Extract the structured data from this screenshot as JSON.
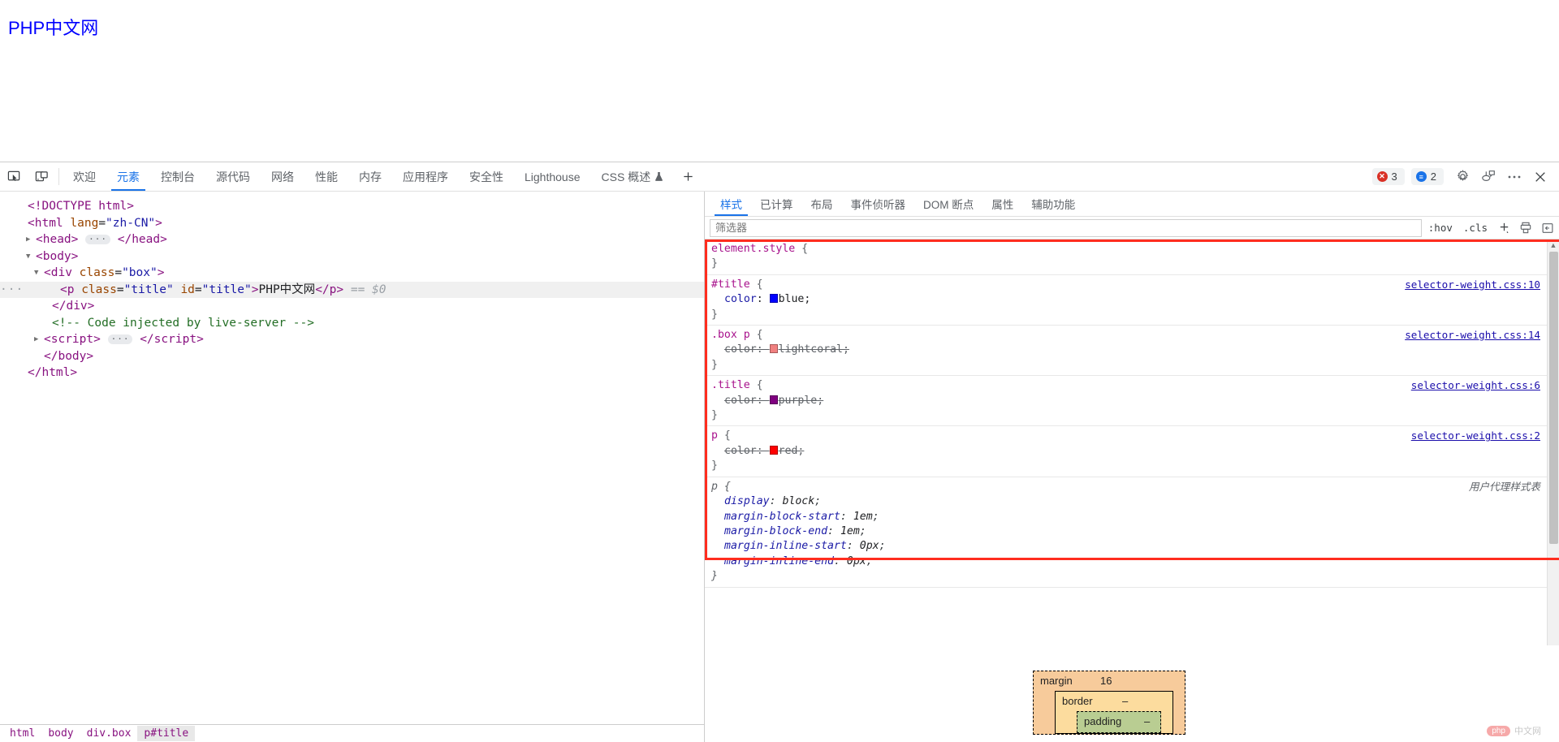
{
  "page": {
    "title_text": "PHP中文网",
    "title_color": "#0000ff"
  },
  "toolbar": {
    "inspect_icon": "inspect-element-icon",
    "device_icon": "device-toolbar-icon",
    "tabs": [
      {
        "label": "欢迎",
        "active": false
      },
      {
        "label": "元素",
        "active": true
      },
      {
        "label": "控制台",
        "active": false
      },
      {
        "label": "源代码",
        "active": false
      },
      {
        "label": "网络",
        "active": false
      },
      {
        "label": "性能",
        "active": false
      },
      {
        "label": "内存",
        "active": false
      },
      {
        "label": "应用程序",
        "active": false
      },
      {
        "label": "安全性",
        "active": false
      },
      {
        "label": "Lighthouse",
        "active": false
      },
      {
        "label": "CSS 概述",
        "active": false,
        "flask": "🧪"
      }
    ],
    "add_tab_label": "+",
    "error_count": "3",
    "message_count": "2",
    "settings_icon": "gear-icon",
    "customize_icon": "customize-devtools-icon",
    "more_icon": "more-options-icon",
    "close_icon": "close-icon"
  },
  "dom": {
    "lines": [
      {
        "indent": 0,
        "arrow": "",
        "html": "<span class=\"pk\">&lt;!DOCTYPE html&gt;</span>"
      },
      {
        "indent": 0,
        "arrow": "",
        "html": "<span class=\"pk\">&lt;</span><span class=\"tw\">html</span> <span class=\"an\">lang</span>=<span class=\"av\">\"zh-CN\"</span><span class=\"pk\">&gt;</span>"
      },
      {
        "indent": 1,
        "arrow": "closed",
        "html": "<span class=\"pk\">&lt;</span><span class=\"tw\">head</span><span class=\"pk\">&gt;</span> <span class=\"ellipsis-badge\">···</span> <span class=\"pk\">&lt;/</span><span class=\"tw\">head</span><span class=\"pk\">&gt;</span>"
      },
      {
        "indent": 1,
        "arrow": "open",
        "html": "<span class=\"pk\">&lt;</span><span class=\"tw\">body</span><span class=\"pk\">&gt;</span>"
      },
      {
        "indent": 2,
        "arrow": "open",
        "html": "<span class=\"pk\">&lt;</span><span class=\"tw\">div</span> <span class=\"an\">class</span>=<span class=\"av\">\"box\"</span><span class=\"pk\">&gt;</span>"
      },
      {
        "indent": 4,
        "arrow": "",
        "selected": true,
        "html": "<span class=\"pk\">&lt;</span><span class=\"tw\">p</span> <span class=\"an\">class</span>=<span class=\"av\">\"title\"</span> <span class=\"an\">id</span>=<span class=\"av\">\"title\"</span><span class=\"pk\">&gt;</span><span class=\"txt\">PHP中文网</span><span class=\"pk\">&lt;/</span><span class=\"tw\">p</span><span class=\"pk\">&gt;</span> <span class=\"dollar\">== $0</span>"
      },
      {
        "indent": 3,
        "arrow": "",
        "html": "<span class=\"pk\">&lt;/</span><span class=\"tw\">div</span><span class=\"pk\">&gt;</span>"
      },
      {
        "indent": 3,
        "arrow": "",
        "html": "<span class=\"cmt\">&lt;!-- Code injected by live-server --&gt;</span>"
      },
      {
        "indent": 2,
        "arrow": "closed",
        "html": "<span class=\"pk\">&lt;</span><span class=\"tw\">script</span><span class=\"pk\">&gt;</span> <span class=\"ellipsis-badge\">···</span> <span class=\"pk\">&lt;/</span><span class=\"tw\">script</span><span class=\"pk\">&gt;</span>"
      },
      {
        "indent": 2,
        "arrow": "",
        "html": "<span class=\"pk\">&lt;/</span><span class=\"tw\">body</span><span class=\"pk\">&gt;</span>"
      },
      {
        "indent": 0,
        "arrow": "",
        "html": "<span class=\"pk\">&lt;/</span><span class=\"tw\">html</span><span class=\"pk\">&gt;</span>"
      }
    ],
    "breadcrumb": [
      "html",
      "body",
      "div.box",
      "p#title"
    ]
  },
  "styles": {
    "tabs": [
      {
        "label": "样式",
        "active": true
      },
      {
        "label": "已计算",
        "active": false
      },
      {
        "label": "布局",
        "active": false
      },
      {
        "label": "事件侦听器",
        "active": false
      },
      {
        "label": "DOM 断点",
        "active": false
      },
      {
        "label": "属性",
        "active": false
      },
      {
        "label": "辅助功能",
        "active": false
      }
    ],
    "filter_placeholder": "筛选器",
    "filter_value": "",
    "hov_label": ":hov",
    "cls_label": ".cls",
    "new_rule_label": "+",
    "toggle_print_icon": "print-media-icon",
    "computed_sidebar_icon": "computed-sidebar-icon",
    "rules": [
      {
        "selector": "element.style",
        "origin": "",
        "ua": false,
        "declarations": []
      },
      {
        "selector": "#title",
        "origin": "selector-weight.css:10",
        "ua": false,
        "declarations": [
          {
            "prop": "color",
            "value": "blue",
            "swatch": "#0000ff",
            "overridden": false
          }
        ]
      },
      {
        "selector": ".box p",
        "origin": "selector-weight.css:14",
        "ua": false,
        "declarations": [
          {
            "prop": "color",
            "value": "lightcoral",
            "swatch": "#f08080",
            "overridden": true
          }
        ]
      },
      {
        "selector": ".title",
        "origin": "selector-weight.css:6",
        "ua": false,
        "declarations": [
          {
            "prop": "color",
            "value": "purple",
            "swatch": "#800080",
            "overridden": true
          }
        ]
      },
      {
        "selector": "p",
        "origin": "selector-weight.css:2",
        "ua": false,
        "declarations": [
          {
            "prop": "color",
            "value": "red",
            "swatch": "#ff0000",
            "overridden": true
          }
        ]
      },
      {
        "selector": "p",
        "origin": "用户代理样式表",
        "ua": true,
        "declarations": [
          {
            "prop": "display",
            "value": "block",
            "swatch": "",
            "overridden": false
          },
          {
            "prop": "margin-block-start",
            "value": "1em",
            "swatch": "",
            "overridden": false
          },
          {
            "prop": "margin-block-end",
            "value": "1em",
            "swatch": "",
            "overridden": false
          },
          {
            "prop": "margin-inline-start",
            "value": "0px",
            "swatch": "",
            "overridden": false
          },
          {
            "prop": "margin-inline-end",
            "value": "0px",
            "swatch": "",
            "overridden": false
          }
        ]
      }
    ],
    "highlight_color": "#ff2d1f"
  },
  "box_model": {
    "margin_label": "margin",
    "margin_value": "16",
    "border_label": "border",
    "border_value": "–",
    "padding_label": "padding",
    "padding_value": "–"
  },
  "watermark": {
    "logo": "php",
    "text": "中文网"
  }
}
